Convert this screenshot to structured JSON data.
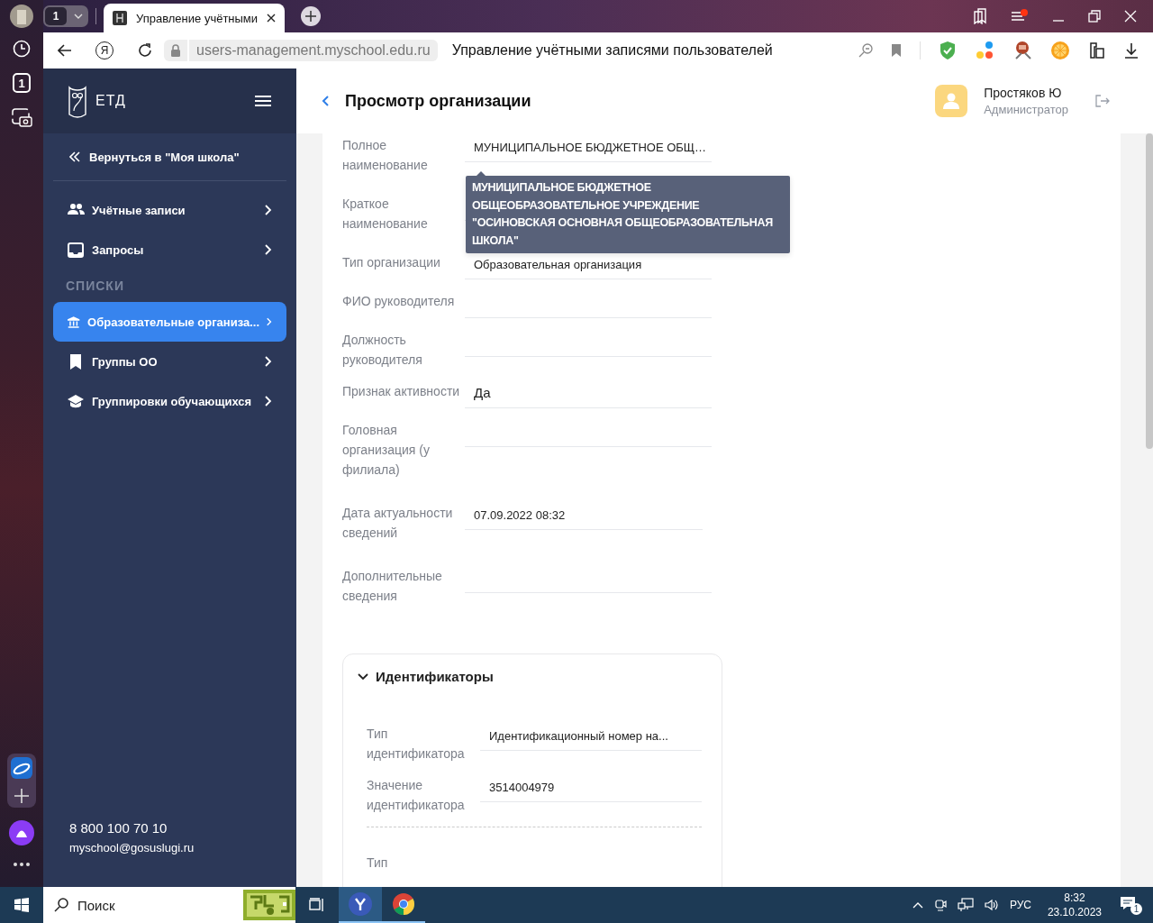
{
  "browser": {
    "rail_tab_counter": "1",
    "tab_counter": "1",
    "tab_title": "Управление учётными",
    "yandex_button": "Я",
    "url": "users-management.myschool.edu.ru",
    "page_title": "Управление учётными записями пользователей"
  },
  "sidebar": {
    "logo": "ЕТД",
    "back_link": "Вернуться в \"Моя школа\"",
    "nav": [
      {
        "kind": "item",
        "label": "Учётные записи",
        "selected": false
      },
      {
        "kind": "item",
        "label": "Запросы",
        "selected": false
      },
      {
        "kind": "heading",
        "label": "СПИСКИ"
      },
      {
        "kind": "item",
        "label": "Образовательные организа...",
        "selected": true
      },
      {
        "kind": "item",
        "label": "Группы ОО",
        "selected": false
      },
      {
        "kind": "item",
        "label": "Группировки обучающихся",
        "selected": false
      }
    ],
    "phone": "8 800 100 70 10",
    "email": "myschool@gosuslugi.ru"
  },
  "header": {
    "title": "Просмотр организации",
    "user_name": "Простяков Ю",
    "user_role": "Администратор"
  },
  "details": {
    "fields": [
      {
        "label": "Полное наименование",
        "value": "МУНИЦИПАЛЬНОЕ БЮДЖЕТНОЕ ОБЩ…"
      },
      {
        "label": "Краткое наименование"
      },
      {
        "label": "Тип организации",
        "value": "Образовательная организация"
      },
      {
        "label": "ФИО руководителя"
      },
      {
        "label": "Должность руководителя"
      },
      {
        "label": "Признак активности",
        "value": "Да"
      },
      {
        "label": "Головная организация (у филиала)"
      },
      {
        "label": "Дата актуальности сведений",
        "value": "07.09.2022 08:32"
      },
      {
        "label": "Дополнительные сведения"
      }
    ],
    "tooltip": "МУНИЦИПАЛЬНОЕ БЮДЖЕТНОЕ ОБЩЕОБРАЗОВАТЕЛЬНОЕ УЧРЕЖДЕНИЕ \"ОСИНОВСКАЯ ОСНОВНАЯ ОБЩЕОБРАЗОВАТЕЛЬНАЯ ШКОЛА\""
  },
  "identifiers": {
    "title": "Идентификаторы",
    "expanded": true,
    "groups": [
      [
        {
          "label": "Тип идентификатора",
          "value": "Идентификационный номер на..."
        },
        {
          "label": "Значение идентификатора",
          "value": "3514004979"
        }
      ],
      [
        {
          "label": "Тип"
        }
      ]
    ]
  },
  "taskbar": {
    "search": "Поиск",
    "language": "РУС",
    "time": "8:32",
    "date": "23.10.2023",
    "notifications": "1"
  }
}
